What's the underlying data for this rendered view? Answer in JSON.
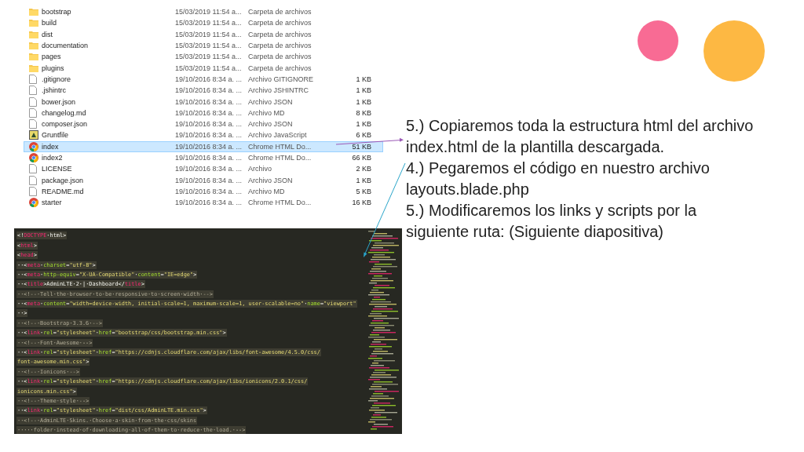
{
  "files": [
    {
      "kind": "folder",
      "name": "bootstrap",
      "date": "15/03/2019 11:54 a...",
      "type": "Carpeta de archivos",
      "selected": false
    },
    {
      "kind": "folder",
      "name": "build",
      "date": "15/03/2019 11:54 a...",
      "type": "Carpeta de archivos",
      "selected": false
    },
    {
      "kind": "folder",
      "name": "dist",
      "date": "15/03/2019 11:54 a...",
      "type": "Carpeta de archivos",
      "selected": false
    },
    {
      "kind": "folder",
      "name": "documentation",
      "date": "15/03/2019 11:54 a...",
      "type": "Carpeta de archivos",
      "selected": false
    },
    {
      "kind": "folder",
      "name": "pages",
      "date": "15/03/2019 11:54 a...",
      "type": "Carpeta de archivos",
      "selected": false
    },
    {
      "kind": "folder",
      "name": "plugins",
      "date": "15/03/2019 11:54 a...",
      "type": "Carpeta de archivos",
      "selected": false
    },
    {
      "kind": "file",
      "name": ".gitignore",
      "date": "19/10/2016 8:34 a. ...",
      "type": "Archivo GITIGNORE",
      "size": "1 KB",
      "selected": false
    },
    {
      "kind": "file",
      "name": ".jshintrc",
      "date": "19/10/2016 8:34 a. ...",
      "type": "Archivo JSHINTRC",
      "size": "1 KB",
      "selected": false
    },
    {
      "kind": "file",
      "name": "bower.json",
      "date": "19/10/2016 8:34 a. ...",
      "type": "Archivo JSON",
      "size": "1 KB",
      "selected": false
    },
    {
      "kind": "file",
      "name": "changelog.md",
      "date": "19/10/2016 8:34 a. ...",
      "type": "Archivo MD",
      "size": "8 KB",
      "selected": false
    },
    {
      "kind": "file",
      "name": "composer.json",
      "date": "19/10/2016 8:34 a. ...",
      "type": "Archivo JSON",
      "size": "1 KB",
      "selected": false
    },
    {
      "kind": "script",
      "name": "Gruntfile",
      "date": "19/10/2016 8:34 a. ...",
      "type": "Archivo JavaScript",
      "size": "6 KB",
      "selected": false
    },
    {
      "kind": "browser",
      "name": "index",
      "date": "19/10/2016 8:34 a. ...",
      "type": "Chrome HTML Do...",
      "size": "51 KB",
      "selected": true
    },
    {
      "kind": "browser",
      "name": "index2",
      "date": "19/10/2016 8:34 a. ...",
      "type": "Chrome HTML Do...",
      "size": "66 KB",
      "selected": false
    },
    {
      "kind": "file",
      "name": "LICENSE",
      "date": "19/10/2016 8:34 a. ...",
      "type": "Archivo",
      "size": "2 KB",
      "selected": false
    },
    {
      "kind": "file",
      "name": "package.json",
      "date": "19/10/2016 8:34 a. ...",
      "type": "Archivo JSON",
      "size": "1 KB",
      "selected": false
    },
    {
      "kind": "file",
      "name": "README.md",
      "date": "19/10/2016 8:34 a. ...",
      "type": "Archivo MD",
      "size": "5 KB",
      "selected": false
    },
    {
      "kind": "browser",
      "name": "starter",
      "date": "19/10/2016 8:34 a. ...",
      "type": "Chrome HTML Do...",
      "size": "16 KB",
      "selected": false
    }
  ],
  "code_lines": [
    [
      {
        "kind": "plain",
        "text": "<!"
      },
      {
        "kind": "tag",
        "text": "DOCTYPE"
      },
      {
        "kind": "plain",
        "text": "·html>"
      }
    ],
    [
      {
        "kind": "plain",
        "text": "<"
      },
      {
        "kind": "tag",
        "text": "html"
      },
      {
        "kind": "plain",
        "text": ">"
      }
    ],
    [
      {
        "kind": "plain",
        "text": "<"
      },
      {
        "kind": "tag",
        "text": "head"
      },
      {
        "kind": "plain",
        "text": ">"
      }
    ],
    [
      {
        "kind": "plain",
        "text": "··<"
      },
      {
        "kind": "tag",
        "text": "meta"
      },
      {
        "kind": "plain",
        "text": "·"
      },
      {
        "kind": "attr",
        "text": "charset"
      },
      {
        "kind": "plain",
        "text": "="
      },
      {
        "kind": "string",
        "text": "\"utf-8\""
      },
      {
        "kind": "plain",
        "text": ">"
      }
    ],
    [
      {
        "kind": "plain",
        "text": "··<"
      },
      {
        "kind": "tag",
        "text": "meta"
      },
      {
        "kind": "plain",
        "text": "·"
      },
      {
        "kind": "attr",
        "text": "http-equiv"
      },
      {
        "kind": "plain",
        "text": "="
      },
      {
        "kind": "string",
        "text": "\"X-UA-Compatible\""
      },
      {
        "kind": "plain",
        "text": "·"
      },
      {
        "kind": "attr",
        "text": "content"
      },
      {
        "kind": "plain",
        "text": "="
      },
      {
        "kind": "string",
        "text": "\"IE=edge\""
      },
      {
        "kind": "plain",
        "text": ">"
      }
    ],
    [
      {
        "kind": "plain",
        "text": "··<"
      },
      {
        "kind": "tag",
        "text": "title"
      },
      {
        "kind": "plain",
        "text": ">AdminLTE·2·|·Dashboard</"
      },
      {
        "kind": "tag",
        "text": "title"
      },
      {
        "kind": "plain",
        "text": ">"
      }
    ],
    [
      {
        "kind": "comment",
        "text": "··<!--·Tell·the·browser·to·be·responsive·to·screen·width·-->"
      }
    ],
    [
      {
        "kind": "plain",
        "text": "··<"
      },
      {
        "kind": "tag",
        "text": "meta"
      },
      {
        "kind": "plain",
        "text": "·"
      },
      {
        "kind": "attr",
        "text": "content"
      },
      {
        "kind": "plain",
        "text": "="
      },
      {
        "kind": "string",
        "text": "\"width=device-width, initial-scale=1, maximum-scale=1, user-scalable=no\""
      },
      {
        "kind": "plain",
        "text": "·"
      },
      {
        "kind": "attr",
        "text": "name"
      },
      {
        "kind": "plain",
        "text": "="
      },
      {
        "kind": "string",
        "text": "\"viewport\""
      }
    ],
    [
      {
        "kind": "plain",
        "text": "··>"
      }
    ],
    [
      {
        "kind": "comment",
        "text": "··<!--·Bootstrap·3.3.6·-->"
      }
    ],
    [
      {
        "kind": "plain",
        "text": "··<"
      },
      {
        "kind": "tag",
        "text": "link"
      },
      {
        "kind": "plain",
        "text": "·"
      },
      {
        "kind": "attr",
        "text": "rel"
      },
      {
        "kind": "plain",
        "text": "="
      },
      {
        "kind": "string",
        "text": "\"stylesheet\""
      },
      {
        "kind": "plain",
        "text": "·"
      },
      {
        "kind": "attr",
        "text": "href"
      },
      {
        "kind": "plain",
        "text": "="
      },
      {
        "kind": "string",
        "text": "\"bootstrap/css/bootstrap.min.css\""
      },
      {
        "kind": "plain",
        "text": ">"
      }
    ],
    [
      {
        "kind": "comment",
        "text": "··<!--·Font·Awesome·-->"
      }
    ],
    [
      {
        "kind": "plain",
        "text": "··<"
      },
      {
        "kind": "tag",
        "text": "link"
      },
      {
        "kind": "plain",
        "text": "·"
      },
      {
        "kind": "attr",
        "text": "rel"
      },
      {
        "kind": "plain",
        "text": "="
      },
      {
        "kind": "string",
        "text": "\"stylesheet\""
      },
      {
        "kind": "plain",
        "text": "·"
      },
      {
        "kind": "attr",
        "text": "href"
      },
      {
        "kind": "plain",
        "text": "="
      },
      {
        "kind": "string",
        "text": "\"https://cdnjs.cloudflare.com/ajax/libs/font-awesome/4.5.0/css/"
      }
    ],
    [
      {
        "kind": "string",
        "text": "font-awesome.min.css\""
      },
      {
        "kind": "plain",
        "text": ">"
      }
    ],
    [
      {
        "kind": "comment",
        "text": "··<!--·Ionicons·-->"
      }
    ],
    [
      {
        "kind": "plain",
        "text": "··<"
      },
      {
        "kind": "tag",
        "text": "link"
      },
      {
        "kind": "plain",
        "text": "·"
      },
      {
        "kind": "attr",
        "text": "rel"
      },
      {
        "kind": "plain",
        "text": "="
      },
      {
        "kind": "string",
        "text": "\"stylesheet\""
      },
      {
        "kind": "plain",
        "text": "·"
      },
      {
        "kind": "attr",
        "text": "href"
      },
      {
        "kind": "plain",
        "text": "="
      },
      {
        "kind": "string",
        "text": "\"https://cdnjs.cloudflare.com/ajax/libs/ionicons/2.0.1/css/"
      }
    ],
    [
      {
        "kind": "string",
        "text": "ionicons.min.css\""
      },
      {
        "kind": "plain",
        "text": ">"
      }
    ],
    [
      {
        "kind": "comment",
        "text": "··<!--·Theme·style·-->"
      }
    ],
    [
      {
        "kind": "plain",
        "text": "··<"
      },
      {
        "kind": "tag",
        "text": "link"
      },
      {
        "kind": "plain",
        "text": "·"
      },
      {
        "kind": "attr",
        "text": "rel"
      },
      {
        "kind": "plain",
        "text": "="
      },
      {
        "kind": "string",
        "text": "\"stylesheet\""
      },
      {
        "kind": "plain",
        "text": "·"
      },
      {
        "kind": "attr",
        "text": "href"
      },
      {
        "kind": "plain",
        "text": "="
      },
      {
        "kind": "string",
        "text": "\"dist/css/AdminLTE.min.css\""
      },
      {
        "kind": "plain",
        "text": ">"
      }
    ],
    [
      {
        "kind": "comment",
        "text": "··<!--·AdminLTE·Skins.·Choose·a·skin·from·the·css/skins"
      }
    ],
    [
      {
        "kind": "comment",
        "text": "·····folder·instead·of·downloading·all·of·them·to·reduce·the·load.·-->"
      }
    ]
  ],
  "notes": [
    "5.) Copiaremos toda la estructura html del archivo index.html de la plantilla descargada.",
    "4.) Pegaremos el código en nuestro archivo layouts.blade.php",
    "5.) Modificaremos los links y scripts por la siguiente ruta: (Siguiente diapositiva)"
  ]
}
